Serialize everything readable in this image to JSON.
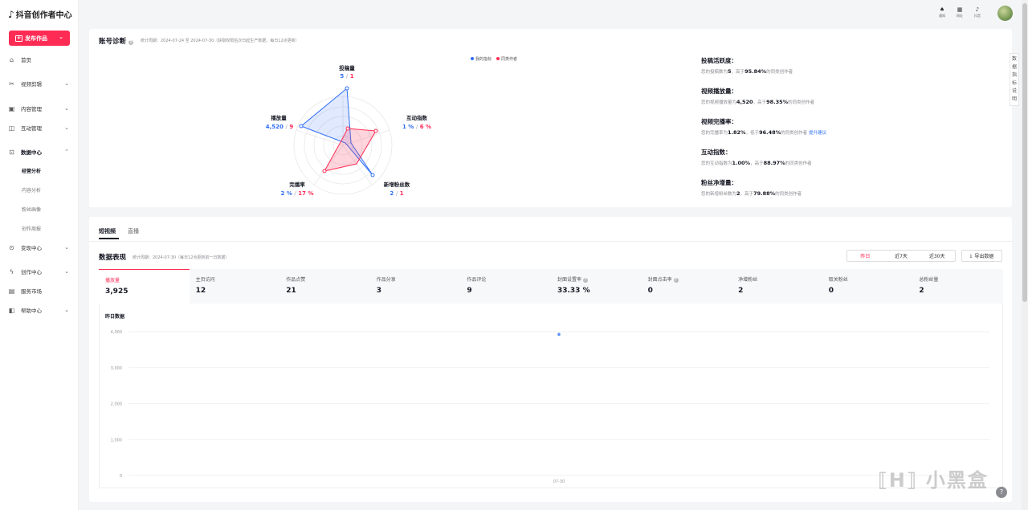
{
  "app": {
    "logo_icon": "douyin-icon",
    "title": "抖音创作者中心"
  },
  "sidebar": {
    "publish_label": "发布作品",
    "items": [
      {
        "label": "首页",
        "icon": "home-icon",
        "chevron": ""
      },
      {
        "label": "视频剪辑",
        "icon": "scissors-icon",
        "chevron": "⌄"
      },
      {
        "label": "内容管理",
        "icon": "content-icon",
        "chevron": "⌄"
      },
      {
        "label": "互动管理",
        "icon": "chat-icon",
        "chevron": "⌄"
      },
      {
        "label": "数据中心",
        "icon": "chart-icon",
        "chevron": "⌃"
      },
      {
        "label": "变现中心",
        "icon": "money-icon",
        "chevron": "⌄"
      },
      {
        "label": "创作中心",
        "icon": "creative-icon",
        "chevron": "⌄"
      },
      {
        "label": "服务市场",
        "icon": "store-icon",
        "chevron": ""
      },
      {
        "label": "帮助中心",
        "icon": "book-icon",
        "chevron": "⌄"
      }
    ],
    "sub_items": [
      "经营分析",
      "内容分析",
      "粉丝画像",
      "创作周报"
    ]
  },
  "topbar": {
    "icons": [
      {
        "label": "通知",
        "icon": "bell-icon"
      },
      {
        "label": "网址",
        "icon": "grid-icon"
      },
      {
        "label": "抖音",
        "icon": "douyin-icon"
      }
    ]
  },
  "diagnosis": {
    "title": "账号诊断",
    "period": "统计周期：2024-07-24 至 2024-07-30（获取权限后次日起生产数据，每日12点更新）",
    "legend": {
      "mine": "我的指标",
      "peer": "同类作者"
    },
    "colors": {
      "mine": "#2f6ef6",
      "peer": "#fe2c55"
    },
    "radar": [
      {
        "label": "投稿量",
        "mine": "5",
        "peer": "1"
      },
      {
        "label": "互动指数",
        "mine": "1 %",
        "peer": "6 %"
      },
      {
        "label": "新增粉丝数",
        "mine": "2",
        "peer": "1"
      },
      {
        "label": "完播率",
        "mine": "2 %",
        "peer": "17 %"
      },
      {
        "label": "播放量",
        "mine": "4,520",
        "peer": "9"
      }
    ],
    "items": [
      {
        "title": "投稿活跃度：",
        "pre": "您的投稿数为",
        "value": "5",
        "mid": "，高于",
        "pct": "95.84%",
        "post": "的同类创作者",
        "link": ""
      },
      {
        "title": "视频播放量：",
        "pre": "您的视频播放量为",
        "value": "4,520",
        "mid": "，高于",
        "pct": "98.35%",
        "post": "的同类创作者",
        "link": ""
      },
      {
        "title": "视频完播率：",
        "pre": "您的完播率为",
        "value": "1.82%",
        "mid": "，低于",
        "pct": "96.48%",
        "post": "的同类创作者",
        "link": "提升建议"
      },
      {
        "title": "互动指数：",
        "pre": "您的互动指数为",
        "value": "1.00%",
        "mid": "，高于",
        "pct": "88.97%",
        "post": "的同类创作者",
        "link": ""
      },
      {
        "title": "粉丝净增量：",
        "pre": "您的新增粉丝数为",
        "value": "2",
        "mid": "，高于",
        "pct": "79.88%",
        "post": "的同类创作者",
        "link": ""
      }
    ],
    "side_tab": [
      "数",
      "据",
      "指",
      "标",
      "说",
      "明"
    ]
  },
  "performance": {
    "tabs": [
      "短视频",
      "直播"
    ],
    "title": "数据表现",
    "period": "统计周期：2024-07-30（每日12点更新前一日数据）",
    "ranges": [
      "昨日",
      "近7天",
      "近30天"
    ],
    "export_label": "导出数据",
    "metrics": [
      {
        "label": "播放量",
        "value": "3,925"
      },
      {
        "label": "主页访问",
        "value": "12"
      },
      {
        "label": "作品点赞",
        "value": "21"
      },
      {
        "label": "作品分享",
        "value": "3"
      },
      {
        "label": "作品评论",
        "value": "9"
      },
      {
        "label": "封面设置率",
        "value": "33.33 %",
        "help": "?"
      },
      {
        "label": "封面点击率",
        "value": "0",
        "help": "?"
      },
      {
        "label": "净增粉丝",
        "value": "2"
      },
      {
        "label": "取关粉丝",
        "value": "0"
      },
      {
        "label": "总粉丝量",
        "value": "2"
      }
    ],
    "chart_title": "昨日数据"
  },
  "chart_data": {
    "type": "line",
    "title": "昨日数据",
    "x": [
      "07-30"
    ],
    "series": [
      {
        "values": [
          3925
        ]
      }
    ],
    "ylim": [
      0,
      4000
    ],
    "yticks": [
      "4,000",
      "3,000",
      "2,000",
      "1,000",
      "0"
    ],
    "grid": true,
    "color": "#5b8ff9"
  },
  "watermark": "小黑盒",
  "help_fab": "?"
}
